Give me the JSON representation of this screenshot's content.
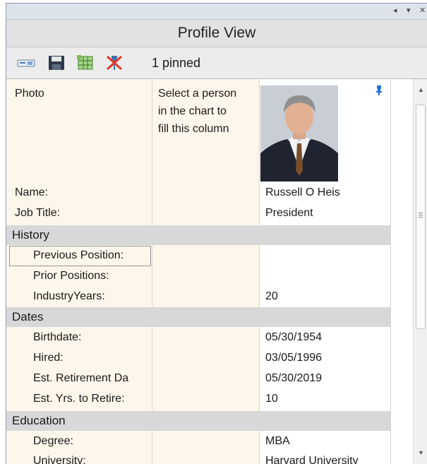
{
  "window": {
    "controls": [
      "◂",
      "▾",
      "✕"
    ]
  },
  "title": "Profile View",
  "toolbar": {
    "icons": [
      "card-icon",
      "save-icon",
      "grid-icon",
      "unpin-icon"
    ],
    "pinned_status": "1 pinned"
  },
  "columns": {
    "placeholder_text": [
      "Select a person",
      "in the chart to",
      "fill this column"
    ]
  },
  "profile": {
    "photo_label": "Photo",
    "name_label": "Name:",
    "name_value": "Russell O Heis",
    "job_title_label": "Job Title:",
    "job_title_value": "President"
  },
  "sections": [
    {
      "title": "History",
      "fields": [
        {
          "label": "Previous Position:",
          "value": ""
        },
        {
          "label": "Prior Positions:",
          "value": ""
        },
        {
          "label": "IndustryYears:",
          "value": "20"
        }
      ]
    },
    {
      "title": "Dates",
      "fields": [
        {
          "label": "Birthdate:",
          "value": "05/30/1954"
        },
        {
          "label": "Hired:",
          "value": "03/05/1996"
        },
        {
          "label": "Est. Retirement Da",
          "value": "05/30/2019"
        },
        {
          "label": "Est. Yrs. to Retire:",
          "value": "10"
        }
      ]
    },
    {
      "title": "Education",
      "fields": [
        {
          "label": "Degree:",
          "value": "MBA"
        },
        {
          "label": "University:",
          "value": "Harvard University"
        }
      ]
    }
  ],
  "colors": {
    "label_column_bg": "#fdf6ea",
    "section_bg": "#d8d8d8",
    "title_bg": "#e2e2e2",
    "pin_blue": "#1f6fd6"
  }
}
